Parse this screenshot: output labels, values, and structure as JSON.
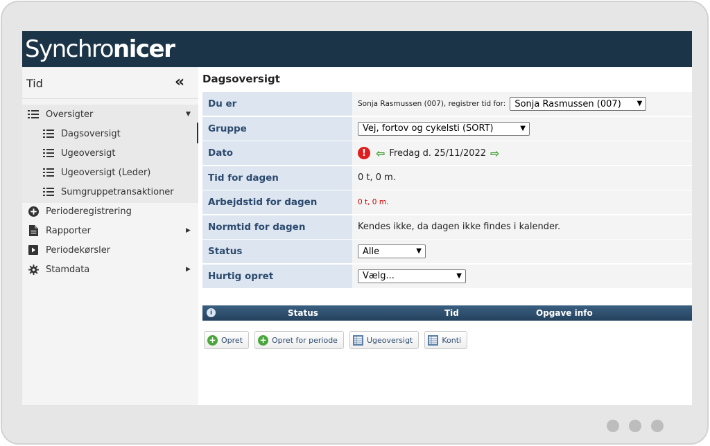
{
  "app": {
    "logo_regular": "Synchro",
    "logo_bold": "nicer"
  },
  "sidebar": {
    "title": "Tid",
    "collapse_icon": "«",
    "items": [
      {
        "label": "Oversigter",
        "icon": "list-icon",
        "expanded": true
      },
      {
        "label": "Dagsoversigt",
        "icon": "list-icon",
        "active": true
      },
      {
        "label": "Ugeoversigt",
        "icon": "list-icon"
      },
      {
        "label": "Ugeoversigt (Leder)",
        "icon": "list-icon"
      },
      {
        "label": "Sumgruppetransaktioner",
        "icon": "list-icon"
      },
      {
        "label": "Perioderegistrering",
        "icon": "plus-circle-icon"
      },
      {
        "label": "Rapporter",
        "icon": "document-icon",
        "has_submenu": true
      },
      {
        "label": "Periodekørsler",
        "icon": "play-icon"
      },
      {
        "label": "Stamdata",
        "icon": "gear-icon",
        "has_submenu": true
      }
    ]
  },
  "main": {
    "title": "Dagsoversigt",
    "rows": {
      "du_er": {
        "label": "Du er",
        "prefix": "Sonja Rasmussen (007), registrer tid for:",
        "select": "Sonja Rasmussen (007)"
      },
      "gruppe": {
        "label": "Gruppe",
        "select": "Vej, fortov og cykelsti (SORT)"
      },
      "dato": {
        "label": "Dato",
        "value": "Fredag d. 25/11/2022"
      },
      "tid_for_dagen": {
        "label": "Tid for dagen",
        "value": "0 t, 0 m."
      },
      "arbejdstid": {
        "label": "Arbejdstid for dagen",
        "value": "0 t, 0 m."
      },
      "normtid": {
        "label": "Normtid for dagen",
        "value": "Kendes ikke, da dagen ikke findes i kalender."
      },
      "status": {
        "label": "Status",
        "select": "Alle"
      },
      "hurtig": {
        "label": "Hurtig opret",
        "select": "Vælg..."
      }
    },
    "grid": {
      "columns": [
        "Status",
        "Tid",
        "Opgave info"
      ]
    },
    "buttons": {
      "opret": "Opret",
      "opret_periode": "Opret for periode",
      "ugeoversigt": "Ugeoversigt",
      "konti": "Konti"
    }
  },
  "colors": {
    "topbar": "#1b3447",
    "label_bg": "#dde6f0",
    "label_text": "#2c4a6e",
    "alert": "#e01e1e",
    "nav_arrow": "#3a9a2a"
  }
}
